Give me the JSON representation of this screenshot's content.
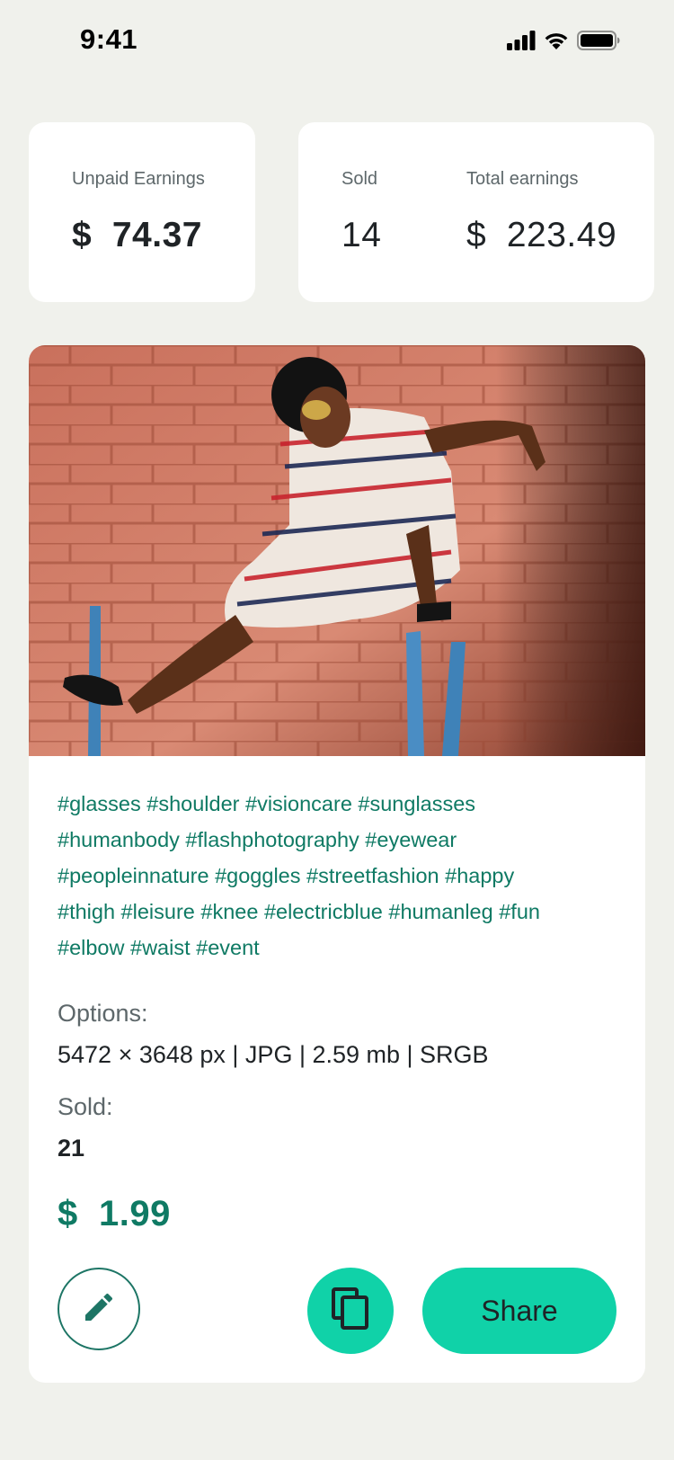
{
  "status_bar": {
    "time": "9:41"
  },
  "stats": {
    "unpaid_label": "Unpaid Earnings",
    "unpaid_value": "$  74.37",
    "sold_label": "Sold",
    "sold_value": "14",
    "total_label": "Total earnings",
    "total_value": "$  223.49"
  },
  "product": {
    "tag_lines": [
      "#glasses #shoulder #visioncare #sunglasses",
      "#humanbody #flashphotography #eyewear",
      "#peopleinnature #goggles #streetfashion #happy",
      "#thigh #leisure #knee #electricblue #humanleg #fun",
      "#elbow #waist #event"
    ],
    "options_label": "Options:",
    "options_value": "5472 × 3648 px | JPG | 2.59 mb | SRGB",
    "sold_label": "Sold:",
    "sold_value": "21",
    "price": "$  1.99"
  },
  "actions": {
    "edit_icon": "pencil-icon",
    "copy_icon": "copy-icon",
    "share_label": "Share"
  },
  "colors": {
    "background": "#F0F1EC",
    "accent": "#10D2A8",
    "tag_text": "#0F7A64"
  }
}
